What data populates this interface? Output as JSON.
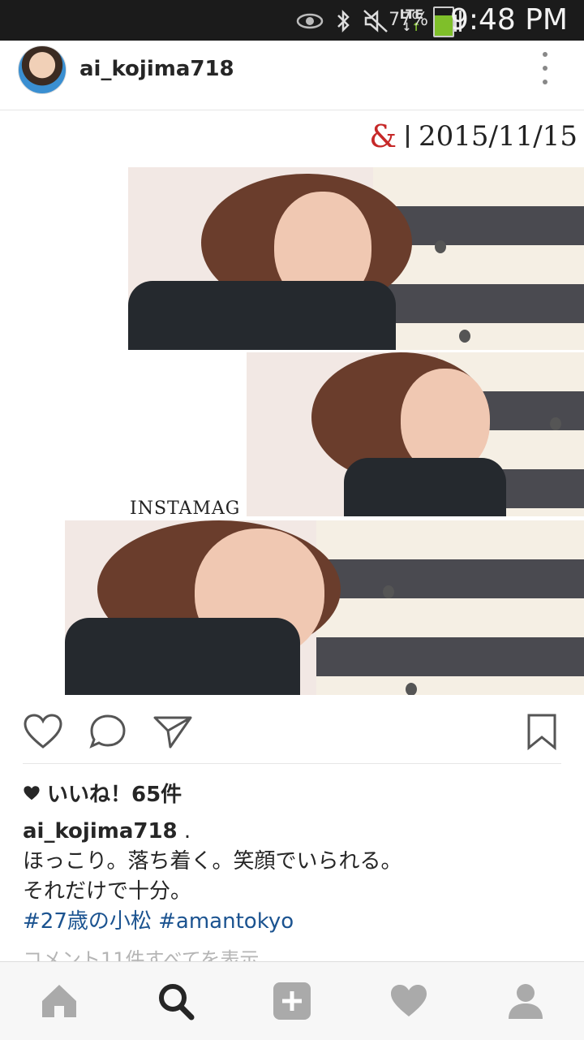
{
  "status_bar": {
    "battery_percent": "77%",
    "time": "9:48 PM",
    "network": "LTE",
    "icons": [
      "eye-icon",
      "bluetooth-icon",
      "mute-icon",
      "lte-icon",
      "signal-icon",
      "battery-icon"
    ]
  },
  "post": {
    "username": "ai_kojima718",
    "image_text": {
      "ampersand": "&",
      "date": "2015/11/15",
      "watermark": "INSTAMAG"
    },
    "likes": "いいね！65件",
    "caption_user": "ai_kojima718",
    "caption_user_suffix": ".",
    "caption_line1": "ほっこり。落ち着く。笑顔でいられる。",
    "caption_line2": "それだけで十分。",
    "hashtag1": "#27歳の小松",
    "hashtag2": "#amantokyo",
    "view_comments": "コメント11件すべてを表示"
  },
  "colors": {
    "status_bar_bg": "#1b1b1b",
    "hashtag": "#1b5390",
    "battery_fill": "#7fbf2a",
    "ampersand": "#c62828"
  },
  "nav": [
    "home-icon",
    "search-icon",
    "add-post-icon",
    "activity-heart-icon",
    "profile-icon"
  ]
}
